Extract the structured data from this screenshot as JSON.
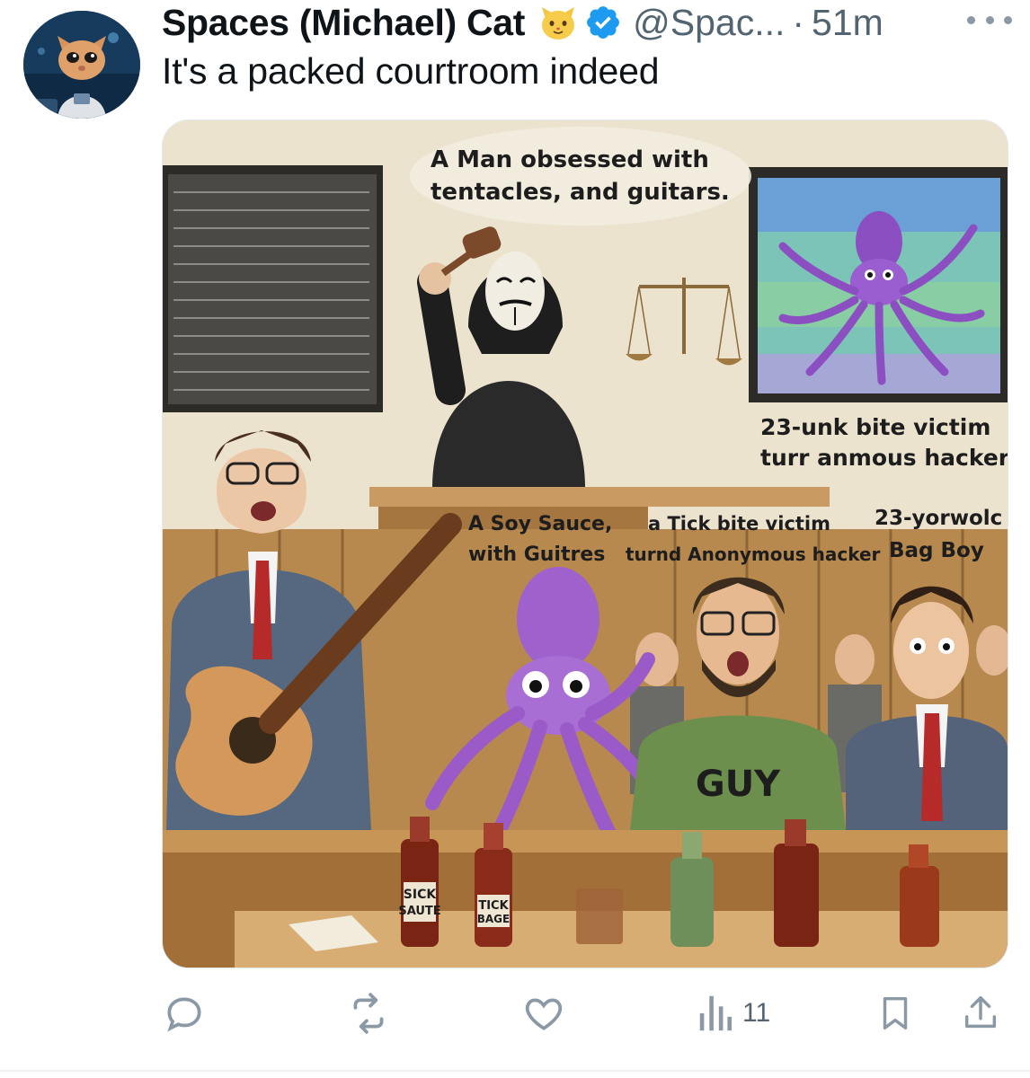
{
  "post": {
    "display_name": "Spaces (Michael) Cat",
    "handle": "@Spac...",
    "separator": "·",
    "time": "51m",
    "text": "It's a packed courtroom indeed"
  },
  "icons": {
    "name_emoji": "cat-face-icon",
    "verified": "verified-badge-icon",
    "more": "more-dots-icon",
    "reply": "reply-icon",
    "repost": "repost-icon",
    "like": "heart-icon",
    "views": "views-bars-icon",
    "bookmark": "bookmark-icon",
    "share": "share-icon"
  },
  "image": {
    "bubbles": {
      "top_line1": "A Man obsessed with",
      "top_line2": "tentacles, and guitars.",
      "right_line1": "23-unk bite victim",
      "right_line2": "turr anmous hacker",
      "soy_line1": "A Soy Sauce,",
      "soy_line2": "with Guitres",
      "tick_line1": "a Tick bite victim",
      "tick_line2": "turnd Anonymous hacker",
      "bag_line1": "23-yorwolc",
      "bag_line2": "Bag Boy"
    },
    "shirt_text": "GUY",
    "bottle1_label_line1": "SICK",
    "bottle1_label_line2": "SAUTE",
    "bottle2_label_line1": "TICK",
    "bottle2_label_line2": "BAGE"
  },
  "actions": {
    "views_count": "11"
  },
  "colors": {
    "verified_blue": "#1d9bf0",
    "secondary_text": "#536471",
    "icon_gray": "#8b98a5"
  }
}
